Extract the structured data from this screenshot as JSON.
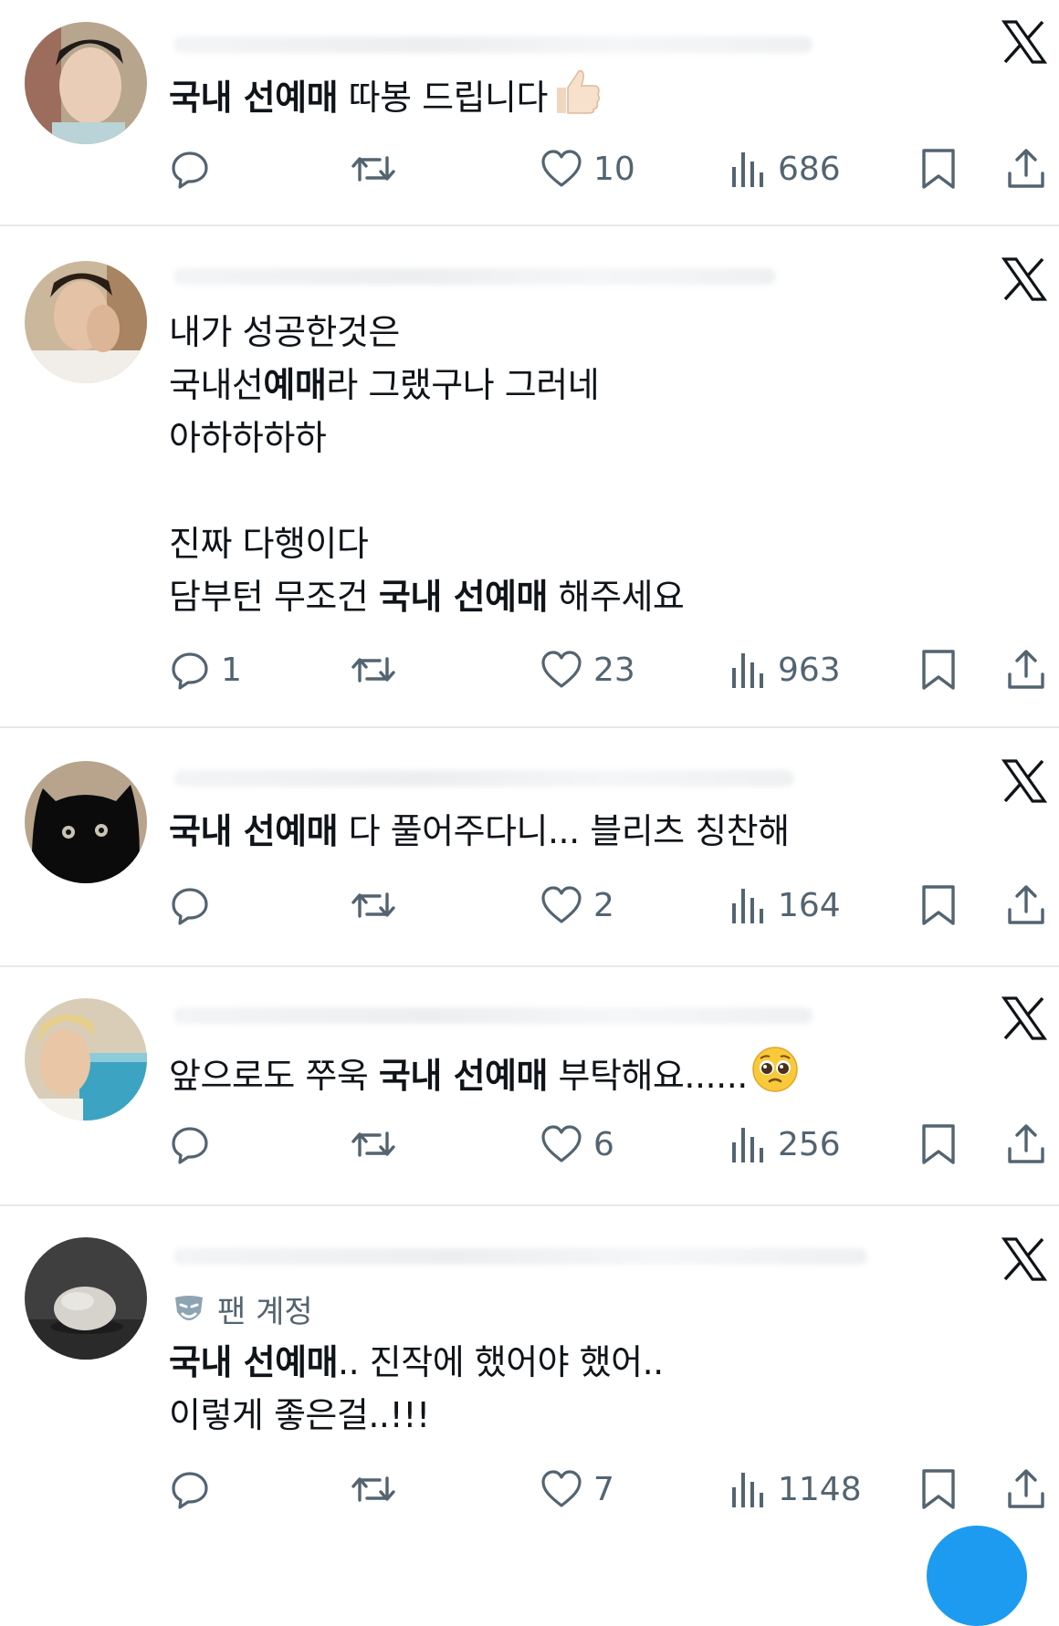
{
  "colors": {
    "text": "#0f1419",
    "muted": "#536471",
    "divider": "#e6e8ea",
    "accent": "#1d9bf0"
  },
  "icons": {
    "reply": "speech-bubble-icon",
    "repost": "repost-arrows-icon",
    "like": "heart-outline-icon",
    "views": "bar-chart-icon",
    "bookmark": "bookmark-icon",
    "share": "share-upload-icon",
    "platform": "x-logo-icon",
    "fan_badge": "theater-mask-icon"
  },
  "posts": [
    {
      "lines": [
        {
          "segments": [
            {
              "text": "국내 선예매",
              "bold": true
            },
            {
              "text": " 따봉 드립니다",
              "bold": false
            }
          ],
          "emoji": "thumbs-up"
        }
      ],
      "stats": {
        "reply": "",
        "like": "10",
        "views": "686"
      }
    },
    {
      "lines": [
        {
          "segments": [
            {
              "text": "내가 성공한것은",
              "bold": false
            }
          ]
        },
        {
          "segments": [
            {
              "text": "국내선",
              "bold": false
            },
            {
              "text": "예매",
              "bold": true
            },
            {
              "text": "라 그랬구나 그러네",
              "bold": false
            }
          ]
        },
        {
          "segments": [
            {
              "text": "아하하하하",
              "bold": false
            }
          ]
        },
        {
          "blank": true
        },
        {
          "segments": [
            {
              "text": "진짜 다행이다",
              "bold": false
            }
          ]
        },
        {
          "segments": [
            {
              "text": "담부턴 무조건 ",
              "bold": false
            },
            {
              "text": "국내 선예매",
              "bold": true
            },
            {
              "text": " 해주세요",
              "bold": false
            }
          ]
        }
      ],
      "stats": {
        "reply": "1",
        "like": "23",
        "views": "963"
      }
    },
    {
      "lines": [
        {
          "segments": [
            {
              "text": "국내 선예매",
              "bold": true
            },
            {
              "text": " 다 풀어주다니... 블리츠 칭찬해",
              "bold": false
            }
          ]
        }
      ],
      "stats": {
        "reply": "",
        "like": "2",
        "views": "164"
      }
    },
    {
      "lines": [
        {
          "segments": [
            {
              "text": "앞으로도 쭈욱 ",
              "bold": false
            },
            {
              "text": "국내 선예매",
              "bold": true
            },
            {
              "text": " 부탁해요......",
              "bold": false
            }
          ],
          "emoji": "pleading-face"
        }
      ],
      "stats": {
        "reply": "",
        "like": "6",
        "views": "256"
      }
    },
    {
      "badge": "팬 계정",
      "lines": [
        {
          "segments": [
            {
              "text": "국내 선예매",
              "bold": true
            },
            {
              "text": ".. 진작에 했어야 했어..",
              "bold": false
            }
          ]
        },
        {
          "segments": [
            {
              "text": "이렇게 좋은걸..!!!",
              "bold": false
            }
          ]
        }
      ],
      "stats": {
        "reply": "",
        "like": "7",
        "views": "1148"
      }
    }
  ]
}
